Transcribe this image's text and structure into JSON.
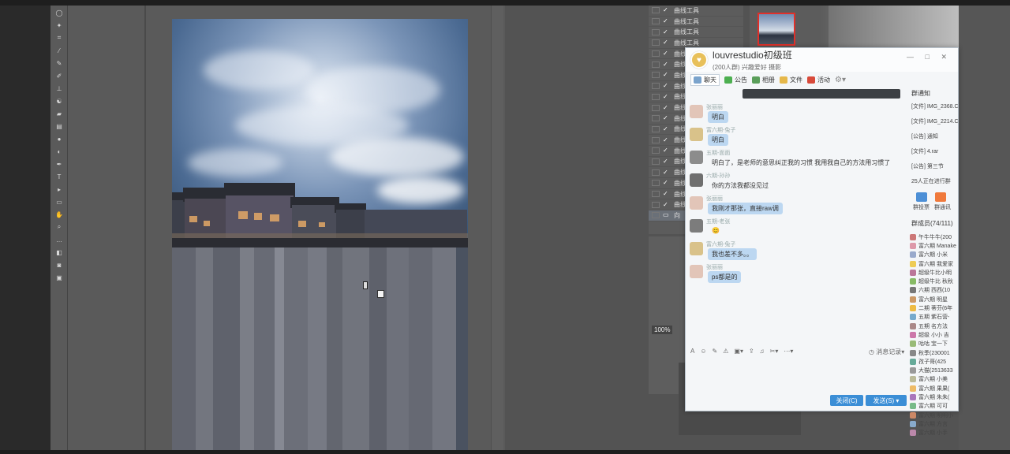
{
  "app": {
    "name": "Photoshop"
  },
  "layers": {
    "items": [
      "曲线工具",
      "曲线工具",
      "曲线工具",
      "曲线工具",
      "曲线工具",
      "曲线工具",
      "曲线工具",
      "曲线工具",
      "曲线工具",
      "曲线工具",
      "曲线工具",
      "曲线工具",
      "曲线工具",
      "曲线工具",
      "曲线工具",
      "曲线工具",
      "曲线工具",
      "曲线工具",
      "曲线工具",
      "向"
    ]
  },
  "navigator": {
    "zoom": "100%"
  },
  "qq": {
    "group_name": "louvrestudio初级班",
    "group_info": "(200人群) 兴趣爱好 摄影",
    "tabs": [
      "聊天",
      "公告",
      "相册",
      "文件",
      "活动"
    ],
    "messages": [
      {
        "name": "张丽丽",
        "text": "明白",
        "style": "blue"
      },
      {
        "name": "富六期-兔子",
        "text": "明白",
        "style": "blue"
      },
      {
        "name": "五期-面面",
        "text": "明白了，是老师的意思纠正我的习惯 我用我自己的方法用习惯了",
        "style": "plain"
      },
      {
        "name": "六期-孙孙",
        "text": "你的方法我都没见过",
        "style": "plain"
      },
      {
        "name": "张丽丽",
        "text": "我刚才那张，直接raw调",
        "style": "blue"
      },
      {
        "name": "五期-老张",
        "text": "😊",
        "style": "plain"
      },
      {
        "name": "富六期-兔子",
        "text": "我也差不多。。",
        "style": "blue"
      },
      {
        "name": "张丽丽",
        "text": "ps都是的",
        "style": "blue"
      }
    ],
    "history_label": "消息记录",
    "close_label": "关闭(C)",
    "send_label": "发送(S)",
    "notice_title": "群通知",
    "notices": [
      "[文件] IMG_2368.C",
      "[文件] IMG_2214.C",
      "[公告] 通知",
      "[文件] 4.rar",
      "[公告] 第三节"
    ],
    "activity": "25人正在进行群",
    "apps": [
      "群投票",
      "群通讯"
    ],
    "members_title": "群成员(74/111)",
    "members": [
      "午牛牛牛(200",
      "富六期 Manake",
      "富六期 小米",
      "富六期 我爱家",
      "超级牛比小明",
      "超级牛比 秋秋",
      "六期 西西(10",
      "富六期 明星",
      "二期 蒂芬(6年",
      "五期 紫石营-",
      "五期 名方法",
      "超级 小小 吉",
      "咕咕 宝一下",
      "秋季(230001",
      "孜子哥(425",
      "大猫(2513633",
      "富六期 小美",
      "富六期 果果(",
      "富六期 朱朱(",
      "富六期 可可",
      "富六期 明明小",
      "富六期 方言",
      "富六期 小手"
    ]
  },
  "colors": {
    "accent": "#3b8ed6",
    "bubble": "#bcd7f1"
  }
}
